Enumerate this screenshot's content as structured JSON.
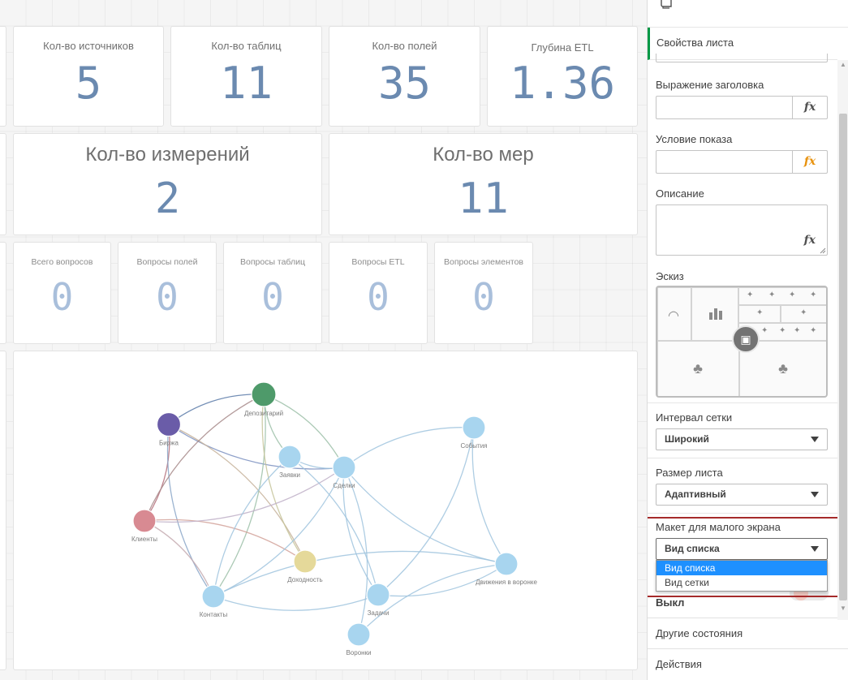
{
  "kpis": [
    {
      "title": "Кол-во источников",
      "value": "5"
    },
    {
      "title": "Кол-во таблиц",
      "value": "11"
    },
    {
      "title": "Кол-во полей",
      "value": "35"
    },
    {
      "title": "Глубина ETL",
      "value": "1.36"
    }
  ],
  "big_kpis": [
    {
      "title": "Кол-во измерений",
      "value": "2"
    },
    {
      "title": "Кол-во мер",
      "value": "11"
    }
  ],
  "questions": [
    {
      "title": "Всего вопросов",
      "value": "0"
    },
    {
      "title": "Вопросы полей",
      "value": "0"
    },
    {
      "title": "Вопросы таблиц",
      "value": "0"
    },
    {
      "title": "Вопросы ETL",
      "value": "0"
    },
    {
      "title": "Вопросы элементов",
      "value": "0"
    }
  ],
  "network": {
    "nodes": [
      {
        "id": "depo",
        "label": "Депозитарий",
        "color": "#4e9a6a"
      },
      {
        "id": "birzha",
        "label": "Биржа",
        "color": "#6a5ca8"
      },
      {
        "id": "klienty",
        "label": "Клиенты",
        "color": "#d88a92"
      },
      {
        "id": "dohod",
        "label": "Доходность",
        "color": "#e5d99a"
      },
      {
        "id": "zayavki",
        "label": "Заявки",
        "color": "#a8d5ef"
      },
      {
        "id": "sdelki",
        "label": "Сделки",
        "color": "#a8d5ef"
      },
      {
        "id": "sobytiya",
        "label": "События",
        "color": "#a8d5ef"
      },
      {
        "id": "kontakty",
        "label": "Контакты",
        "color": "#a8d5ef"
      },
      {
        "id": "zadachi",
        "label": "Задачи",
        "color": "#a8d5ef"
      },
      {
        "id": "dvizh",
        "label": "Движения в воронке",
        "color": "#a8d5ef"
      },
      {
        "id": "voronki",
        "label": "Воронки",
        "color": "#a8d5ef"
      }
    ],
    "edges": [
      {
        "from": "birzha",
        "to": "depo",
        "color": "#5b7aa8"
      },
      {
        "from": "birzha",
        "to": "sdelki",
        "color": "#7a8fc0"
      },
      {
        "from": "birzha",
        "to": "klienty",
        "color": "#b46e7a"
      },
      {
        "from": "birzha",
        "to": "kontakty",
        "color": "#8aa6c8"
      },
      {
        "from": "birzha",
        "to": "dohod",
        "color": "#c6b29a"
      },
      {
        "from": "depo",
        "to": "klienty",
        "color": "#a78a8a"
      },
      {
        "from": "depo",
        "to": "sdelki",
        "color": "#9cc0a8"
      },
      {
        "from": "depo",
        "to": "zayavki",
        "color": "#9cc0a8"
      },
      {
        "from": "depo",
        "to": "kontakty",
        "color": "#9cc0a8"
      },
      {
        "from": "depo",
        "to": "dohod",
        "color": "#c5c49a"
      },
      {
        "from": "klienty",
        "to": "dohod",
        "color": "#d2a29a"
      },
      {
        "from": "klienty",
        "to": "sdelki",
        "color": "#c0b0c8"
      },
      {
        "from": "klienty",
        "to": "kontakty",
        "color": "#c4aab0"
      },
      {
        "from": "zayavki",
        "to": "sdelki",
        "color": "#a0c4de"
      },
      {
        "from": "zayavki",
        "to": "zadachi",
        "color": "#a0c4de"
      },
      {
        "from": "zayavki",
        "to": "kontakty",
        "color": "#a0c4de"
      },
      {
        "from": "sdelki",
        "to": "sobytiya",
        "color": "#a0c4de"
      },
      {
        "from": "sdelki",
        "to": "dvizh",
        "color": "#a0c4de"
      },
      {
        "from": "sdelki",
        "to": "voronki",
        "color": "#a0c4de"
      },
      {
        "from": "sdelki",
        "to": "zadachi",
        "color": "#a0c4de"
      },
      {
        "from": "sdelki",
        "to": "kontakty",
        "color": "#a0c4de"
      },
      {
        "from": "sobytiya",
        "to": "dvizh",
        "color": "#a0c4de"
      },
      {
        "from": "sobytiya",
        "to": "zadachi",
        "color": "#a0c4de"
      },
      {
        "from": "kontakty",
        "to": "zadachi",
        "color": "#a0c4de"
      },
      {
        "from": "kontakty",
        "to": "dvizh",
        "color": "#a0c4de"
      },
      {
        "from": "zadachi",
        "to": "dvizh",
        "color": "#a0c4de"
      },
      {
        "from": "voronki",
        "to": "dvizh",
        "color": "#a0c4de"
      }
    ]
  },
  "panel": {
    "tab": "Свойства листа",
    "title_expr_label": "Выражение заголовка",
    "show_cond_label": "Условие показа",
    "description_label": "Описание",
    "fx": "fx",
    "thumbnail_label": "Эскиз",
    "grid_label": "Интервал сетки",
    "grid_value": "Широкий",
    "size_label": "Размер листа",
    "size_value": "Адаптивный",
    "small_screen_label": "Макет для малого экрана",
    "small_screen_value": "Вид списка",
    "small_screen_options": [
      "Вид списка",
      "Вид сетки"
    ],
    "off_label": "Выкл",
    "other_states": "Другие состояния",
    "actions": "Действия"
  },
  "colors": {
    "accent_green": "#009845",
    "kpi_blue": "#6b8ab0",
    "highlight": "#a52a2a",
    "dropdown_selected": "#1e90ff"
  }
}
